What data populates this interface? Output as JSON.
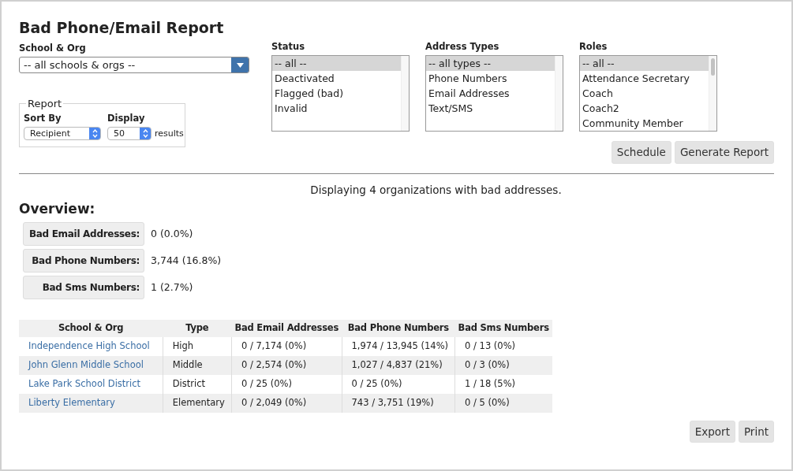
{
  "title": "Bad Phone/Email Report",
  "school_org": {
    "label": "School & Org",
    "value": "-- all schools & orgs --"
  },
  "report": {
    "legend": "Report",
    "sort_by": {
      "label": "Sort By",
      "value": "Recipient"
    },
    "display": {
      "label": "Display",
      "value": "50",
      "suffix": "results"
    }
  },
  "filters": [
    {
      "label": "Status",
      "options": [
        {
          "text": "-- all --",
          "selected": true
        },
        {
          "text": "Deactivated",
          "selected": false
        },
        {
          "text": "Flagged (bad)",
          "selected": false
        },
        {
          "text": "Invalid",
          "selected": false
        }
      ]
    },
    {
      "label": "Address Types",
      "options": [
        {
          "text": "-- all types --",
          "selected": true
        },
        {
          "text": "Phone Numbers",
          "selected": false
        },
        {
          "text": "Email Addresses",
          "selected": false
        },
        {
          "text": "Text/SMS",
          "selected": false
        }
      ]
    },
    {
      "label": "Roles",
      "options": [
        {
          "text": "-- all --",
          "selected": true
        },
        {
          "text": "Attendance Secretary",
          "selected": false
        },
        {
          "text": "Coach",
          "selected": false
        },
        {
          "text": "Coach2",
          "selected": false
        },
        {
          "text": "Community Member",
          "selected": false
        }
      ]
    }
  ],
  "actions": [
    "Schedule",
    "Generate Report"
  ],
  "summary": "Displaying 4 organizations with bad addresses.",
  "overview": {
    "heading": "Overview:",
    "items": [
      {
        "label": "Bad Email Addresses:",
        "value": "0 (0.0%)"
      },
      {
        "label": "Bad Phone Numbers:",
        "value": "3,744 (16.8%)"
      },
      {
        "label": "Bad Sms Numbers:",
        "value": "1 (2.7%)"
      }
    ]
  },
  "table": {
    "columns": [
      "School & Org",
      "Type",
      "Bad Email Addresses",
      "Bad Phone Numbers",
      "Bad Sms Numbers"
    ],
    "rows": [
      {
        "school": "Independence High School",
        "type": "High",
        "email": "0 / 7,174 (0%)",
        "phone": "1,974 / 13,945 (14%)",
        "sms": "0 / 13 (0%)"
      },
      {
        "school": "John Glenn Middle School",
        "type": "Middle",
        "email": "0 / 2,574 (0%)",
        "phone": "1,027 / 4,837 (21%)",
        "sms": "0 / 3 (0%)"
      },
      {
        "school": "Lake Park School District",
        "type": "District",
        "email": "0 / 25 (0%)",
        "phone": "0 / 25 (0%)",
        "sms": "1 / 18 (5%)"
      },
      {
        "school": "Liberty Elementary",
        "type": "Elementary",
        "email": "0 / 2,049 (0%)",
        "phone": "743 / 3,751 (19%)",
        "sms": "0 / 5 (0%)"
      }
    ]
  },
  "footer_actions": [
    "Export",
    "Print"
  ]
}
